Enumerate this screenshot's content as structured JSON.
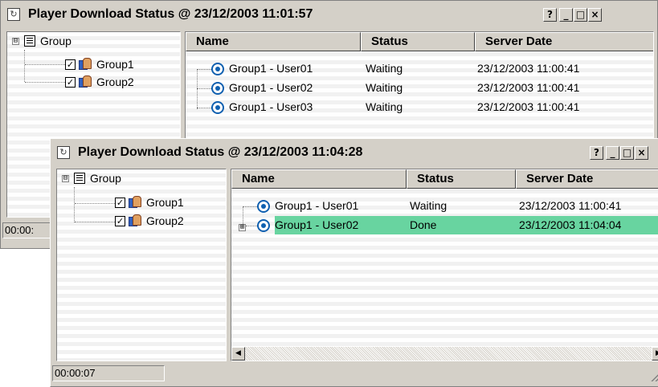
{
  "window1": {
    "title": "Player Download Status @ 23/12/2003 11:01:57",
    "buttons": {
      "help": "?",
      "minimize": "_",
      "maximize": "□",
      "close": "×"
    },
    "tree": {
      "root": "Group",
      "root_expander": "⊟",
      "children": [
        {
          "label": "Group1",
          "checked": true,
          "check": "✓"
        },
        {
          "label": "Group2",
          "checked": true,
          "check": "✓"
        }
      ]
    },
    "columns": [
      "Name",
      "Status",
      "Server Date"
    ],
    "rows": [
      {
        "name": "Group1 - User01",
        "status": "Waiting",
        "date": "23/12/2003 11:00:41"
      },
      {
        "name": "Group1 - User02",
        "status": "Waiting",
        "date": "23/12/2003 11:00:41"
      },
      {
        "name": "Group1 - User03",
        "status": "Waiting",
        "date": "23/12/2003 11:00:41"
      }
    ],
    "status_bar": "00:00:"
  },
  "window2": {
    "title": "Player Download Status @ 23/12/2003 11:04:28",
    "buttons": {
      "help": "?",
      "minimize": "_",
      "maximize": "□",
      "close": "×"
    },
    "tree": {
      "root": "Group",
      "root_expander": "⊟",
      "children": [
        {
          "label": "Group1",
          "checked": true,
          "check": "✓"
        },
        {
          "label": "Group2",
          "checked": true,
          "check": "✓"
        }
      ]
    },
    "columns": [
      "Name",
      "Status",
      "Server Date"
    ],
    "rows": [
      {
        "name": "Group1 - User01",
        "status": "Waiting",
        "date": "23/12/2003 11:00:41",
        "selected": false
      },
      {
        "name": "Group1 - User02",
        "status": "Done",
        "date": "23/12/2003 11:04:04",
        "selected": true,
        "expander": "⊞"
      }
    ],
    "scroll": {
      "left": "◀",
      "right": "▶"
    },
    "status_bar": "00:00:07"
  },
  "colors": {
    "selected_row": "#68d4a0",
    "chrome": "#d4d0c8"
  }
}
